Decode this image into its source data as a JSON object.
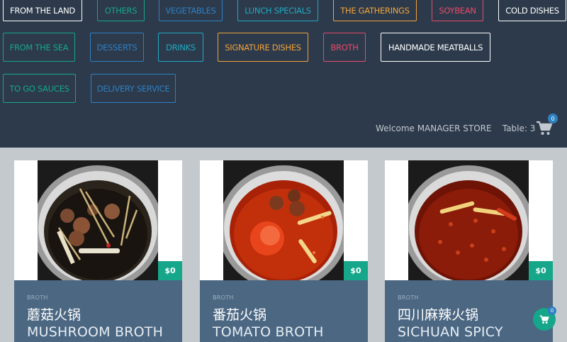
{
  "categories": [
    {
      "label": "FROM THE LAND",
      "color": "#ffffff"
    },
    {
      "label": "OTHERS",
      "color": "#17a68b"
    },
    {
      "label": "VEGETABLES",
      "color": "#2f7fc1"
    },
    {
      "label": "LUNCH SPECIALS",
      "color": "#21a9c2"
    },
    {
      "label": "THE GATHERINGS",
      "color": "#f2a33a"
    },
    {
      "label": "SOYBEAN",
      "color": "#e84a6a"
    },
    {
      "label": "COLD DISHES",
      "color": "#ffffff"
    },
    {
      "label": "FROM THE SEA",
      "color": "#17a68b"
    },
    {
      "label": "DESSERTS",
      "color": "#2f7fc1"
    },
    {
      "label": "DRINKS",
      "color": "#21a9c2"
    },
    {
      "label": "SIGNATURE DISHES",
      "color": "#f2a33a"
    },
    {
      "label": "BROTH",
      "color": "#e84a6a"
    },
    {
      "label": "HANDMADE MEATBALLS",
      "color": "#ffffff"
    },
    {
      "label": "TO GO SAUCES",
      "color": "#17a68b"
    },
    {
      "label": "DELIVERY SERVICE",
      "color": "#2f7fc1"
    }
  ],
  "header": {
    "welcome": "Welcome MANAGER STORE",
    "table": "Table: 3",
    "cart_count": "0"
  },
  "products": [
    {
      "category": "BROTH",
      "name_cn": "蘑菇火锅",
      "name_en": "MUSHROOM BROTH",
      "price": "$0",
      "image": "mushroom-broth-pot"
    },
    {
      "category": "BROTH",
      "name_cn": "番茄火锅",
      "name_en": "TOMATO BROTH",
      "price": "$0",
      "image": "tomato-broth-pot"
    },
    {
      "category": "BROTH",
      "name_cn": "四川麻辣火锅",
      "name_en": "SICHUAN SPICY",
      "price": "$0",
      "image": "sichuan-spicy-pot"
    }
  ],
  "floating_cart": {
    "count": "0"
  },
  "icons": {
    "cart": "shopping-cart-icon"
  },
  "colors": {
    "header_bg": "#2c3a4b",
    "accent": "#16a689",
    "badge": "#2f80c2",
    "card_info_bg": "#4b6782"
  }
}
